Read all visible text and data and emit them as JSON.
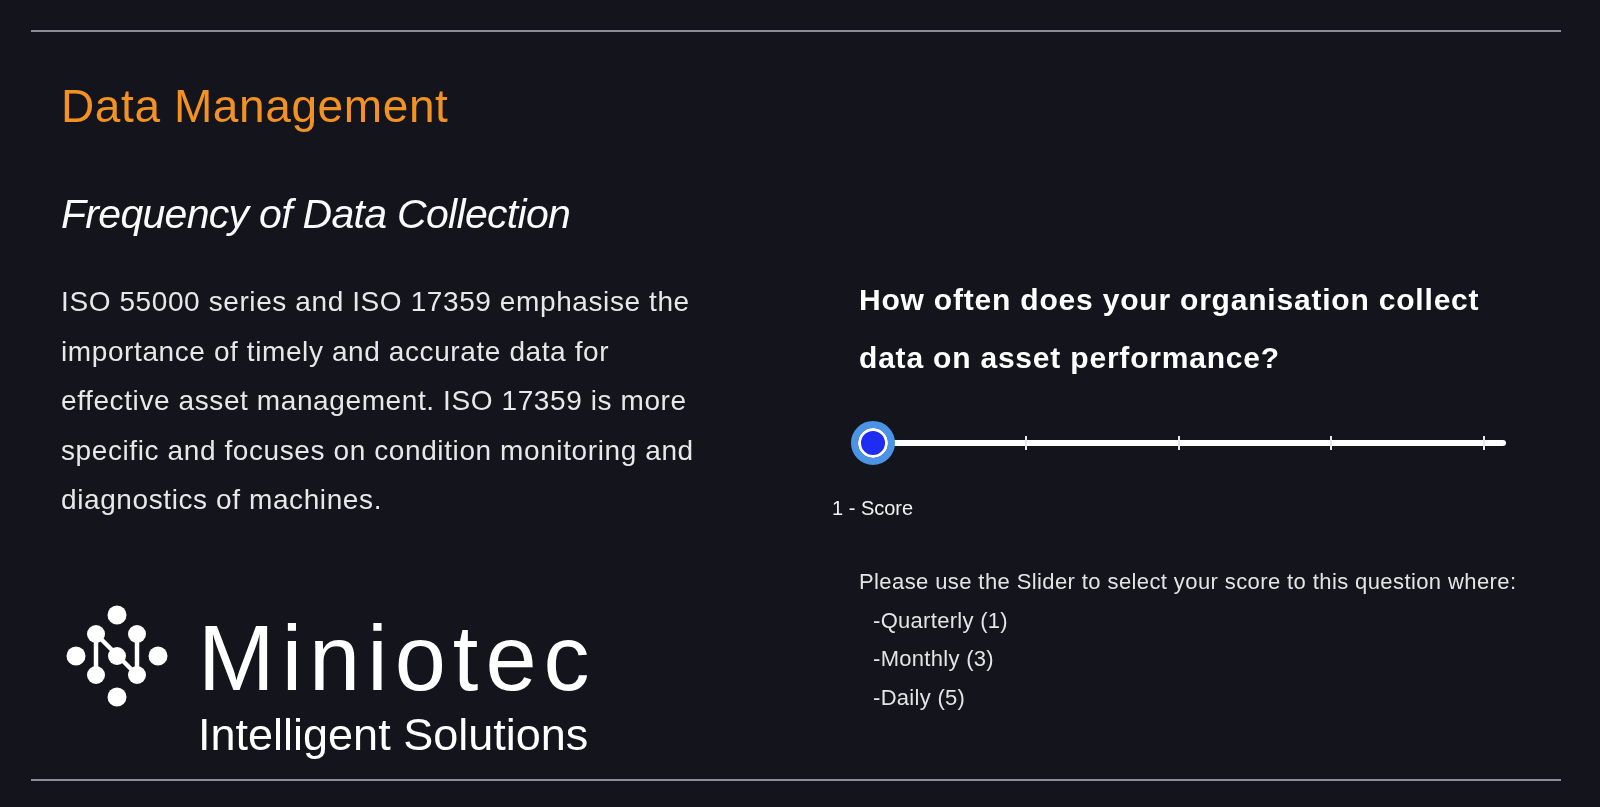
{
  "header": {
    "title": "Data Management",
    "subtitle": "Frequency of Data Collection"
  },
  "description": "ISO 55000 series and ISO 17359 emphasise the importance of timely and accurate data for effective asset management. ISO 17359 is more specific and focuses on condition monitoring and diagnostics of machines.",
  "logo": {
    "name": "Miniotec",
    "tagline": "Intelligent Solutions"
  },
  "question": {
    "text": "How often does your organisation collect data on asset performance?",
    "slider": {
      "level": 0
    },
    "score_label": "1 - Score",
    "instructions": "Please use the Slider to select your score to this question where:",
    "options": [
      "-Quarterly (1)",
      "-Monthly (3)",
      "-Daily (5)"
    ]
  }
}
